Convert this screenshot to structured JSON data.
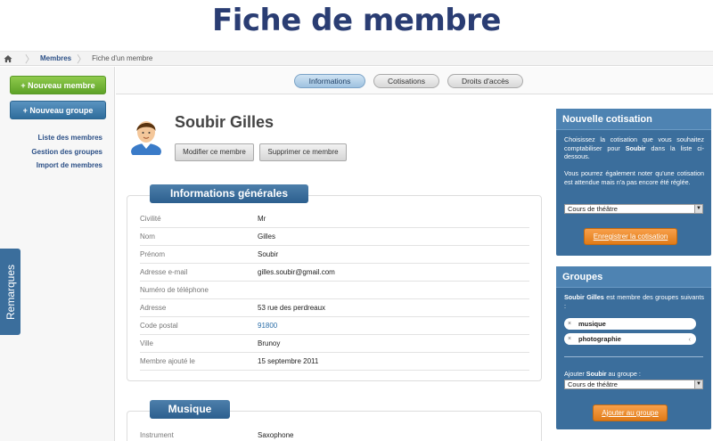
{
  "title": "Fiche de membre",
  "breadcrumb": {
    "home_icon": "home-icon",
    "members": "Membres",
    "current": "Fiche d'un membre"
  },
  "sidebar": {
    "new_member": "+ Nouveau membre",
    "new_group": "+ Nouveau groupe",
    "links": [
      "Liste des membres",
      "Gestion des groupes",
      "Import de membres"
    ],
    "remarks_tab": "Remarques"
  },
  "tabs": [
    {
      "label": "Informations",
      "active": true
    },
    {
      "label": "Cotisations",
      "active": false
    },
    {
      "label": "Droits d'accès",
      "active": false
    }
  ],
  "member": {
    "name": "Soubir Gilles",
    "avatar_icon": "user-avatar-icon",
    "edit_button": "Modifier ce membre",
    "delete_button": "Supprimer ce membre"
  },
  "general_info": {
    "heading": "Informations générales",
    "fields": [
      {
        "label": "Civilité",
        "value": "Mr"
      },
      {
        "label": "Nom",
        "value": "Gilles"
      },
      {
        "label": "Prénom",
        "value": "Soubir"
      },
      {
        "label": "Adresse e-mail",
        "value": "gilles.soubir@gmail.com"
      },
      {
        "label": "Numéro de téléphone",
        "value": ""
      },
      {
        "label": "Adresse",
        "value": "53 rue des perdreaux"
      },
      {
        "label": "Code postal",
        "value": "91800"
      },
      {
        "label": "Ville",
        "value": "Brunoy"
      },
      {
        "label": "Membre ajouté le",
        "value": "15 septembre 2011"
      }
    ]
  },
  "music": {
    "heading": "Musique",
    "fields": [
      {
        "label": "Instrument",
        "value": "Saxophone"
      }
    ]
  },
  "new_contribution": {
    "heading": "Nouvelle cotisation",
    "text1_pre": "Choisissez la cotisation que vous souhaitez comptabiliser pour ",
    "text1_bold": "Soubir",
    "text1_post": " dans la liste ci-dessous.",
    "text2": "Vous pourrez également noter qu'une cotisation est attendue mais n'a pas encore été réglée.",
    "select_value": "Cours de théâtre",
    "submit": "Enregistrer la cotisation"
  },
  "groups": {
    "heading": "Groupes",
    "text_bold1": "Soubir Gilles",
    "text_mid": " est membre des groupes suivants :",
    "tags": [
      "musique",
      "photographie"
    ],
    "add_pre": "Ajouter ",
    "add_bold": "Soubir",
    "add_post": " au groupe :",
    "select_value": "Cours de théâtre",
    "submit": "Ajouter au groupe"
  },
  "colors": {
    "title": "#2a3d73",
    "accent_blue": "#3b6e9c",
    "green": "#5ea328",
    "orange": "#e07b18"
  }
}
